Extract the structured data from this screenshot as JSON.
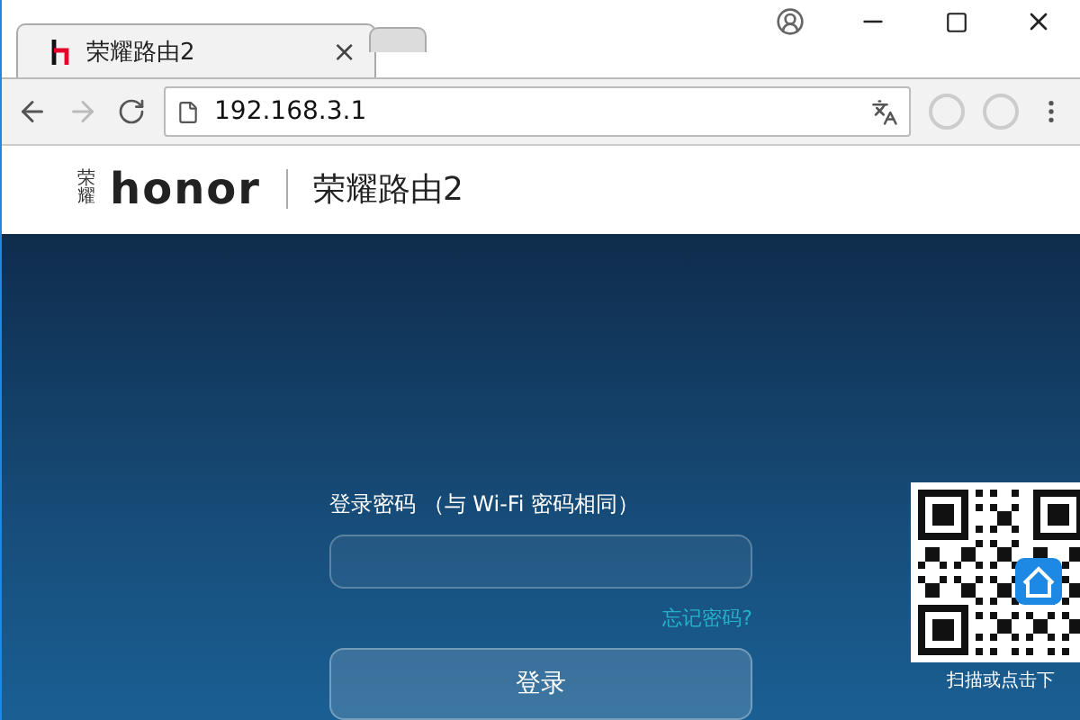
{
  "tabs": [
    {
      "title": "荣耀路由2",
      "selected": true,
      "close": "×"
    },
    {
      "selected": false
    }
  ],
  "address_bar": {
    "url": "192.168.3.1"
  },
  "header": {
    "logo_mark": "荣耀",
    "logo_text": "honor",
    "title": "荣耀路由2"
  },
  "login": {
    "label": "登录密码 （与 Wi-Fi 密码相同）",
    "forgot_link": "忘记密码?",
    "button": "登录"
  },
  "qr": {
    "caption": "扫描或点击下"
  }
}
